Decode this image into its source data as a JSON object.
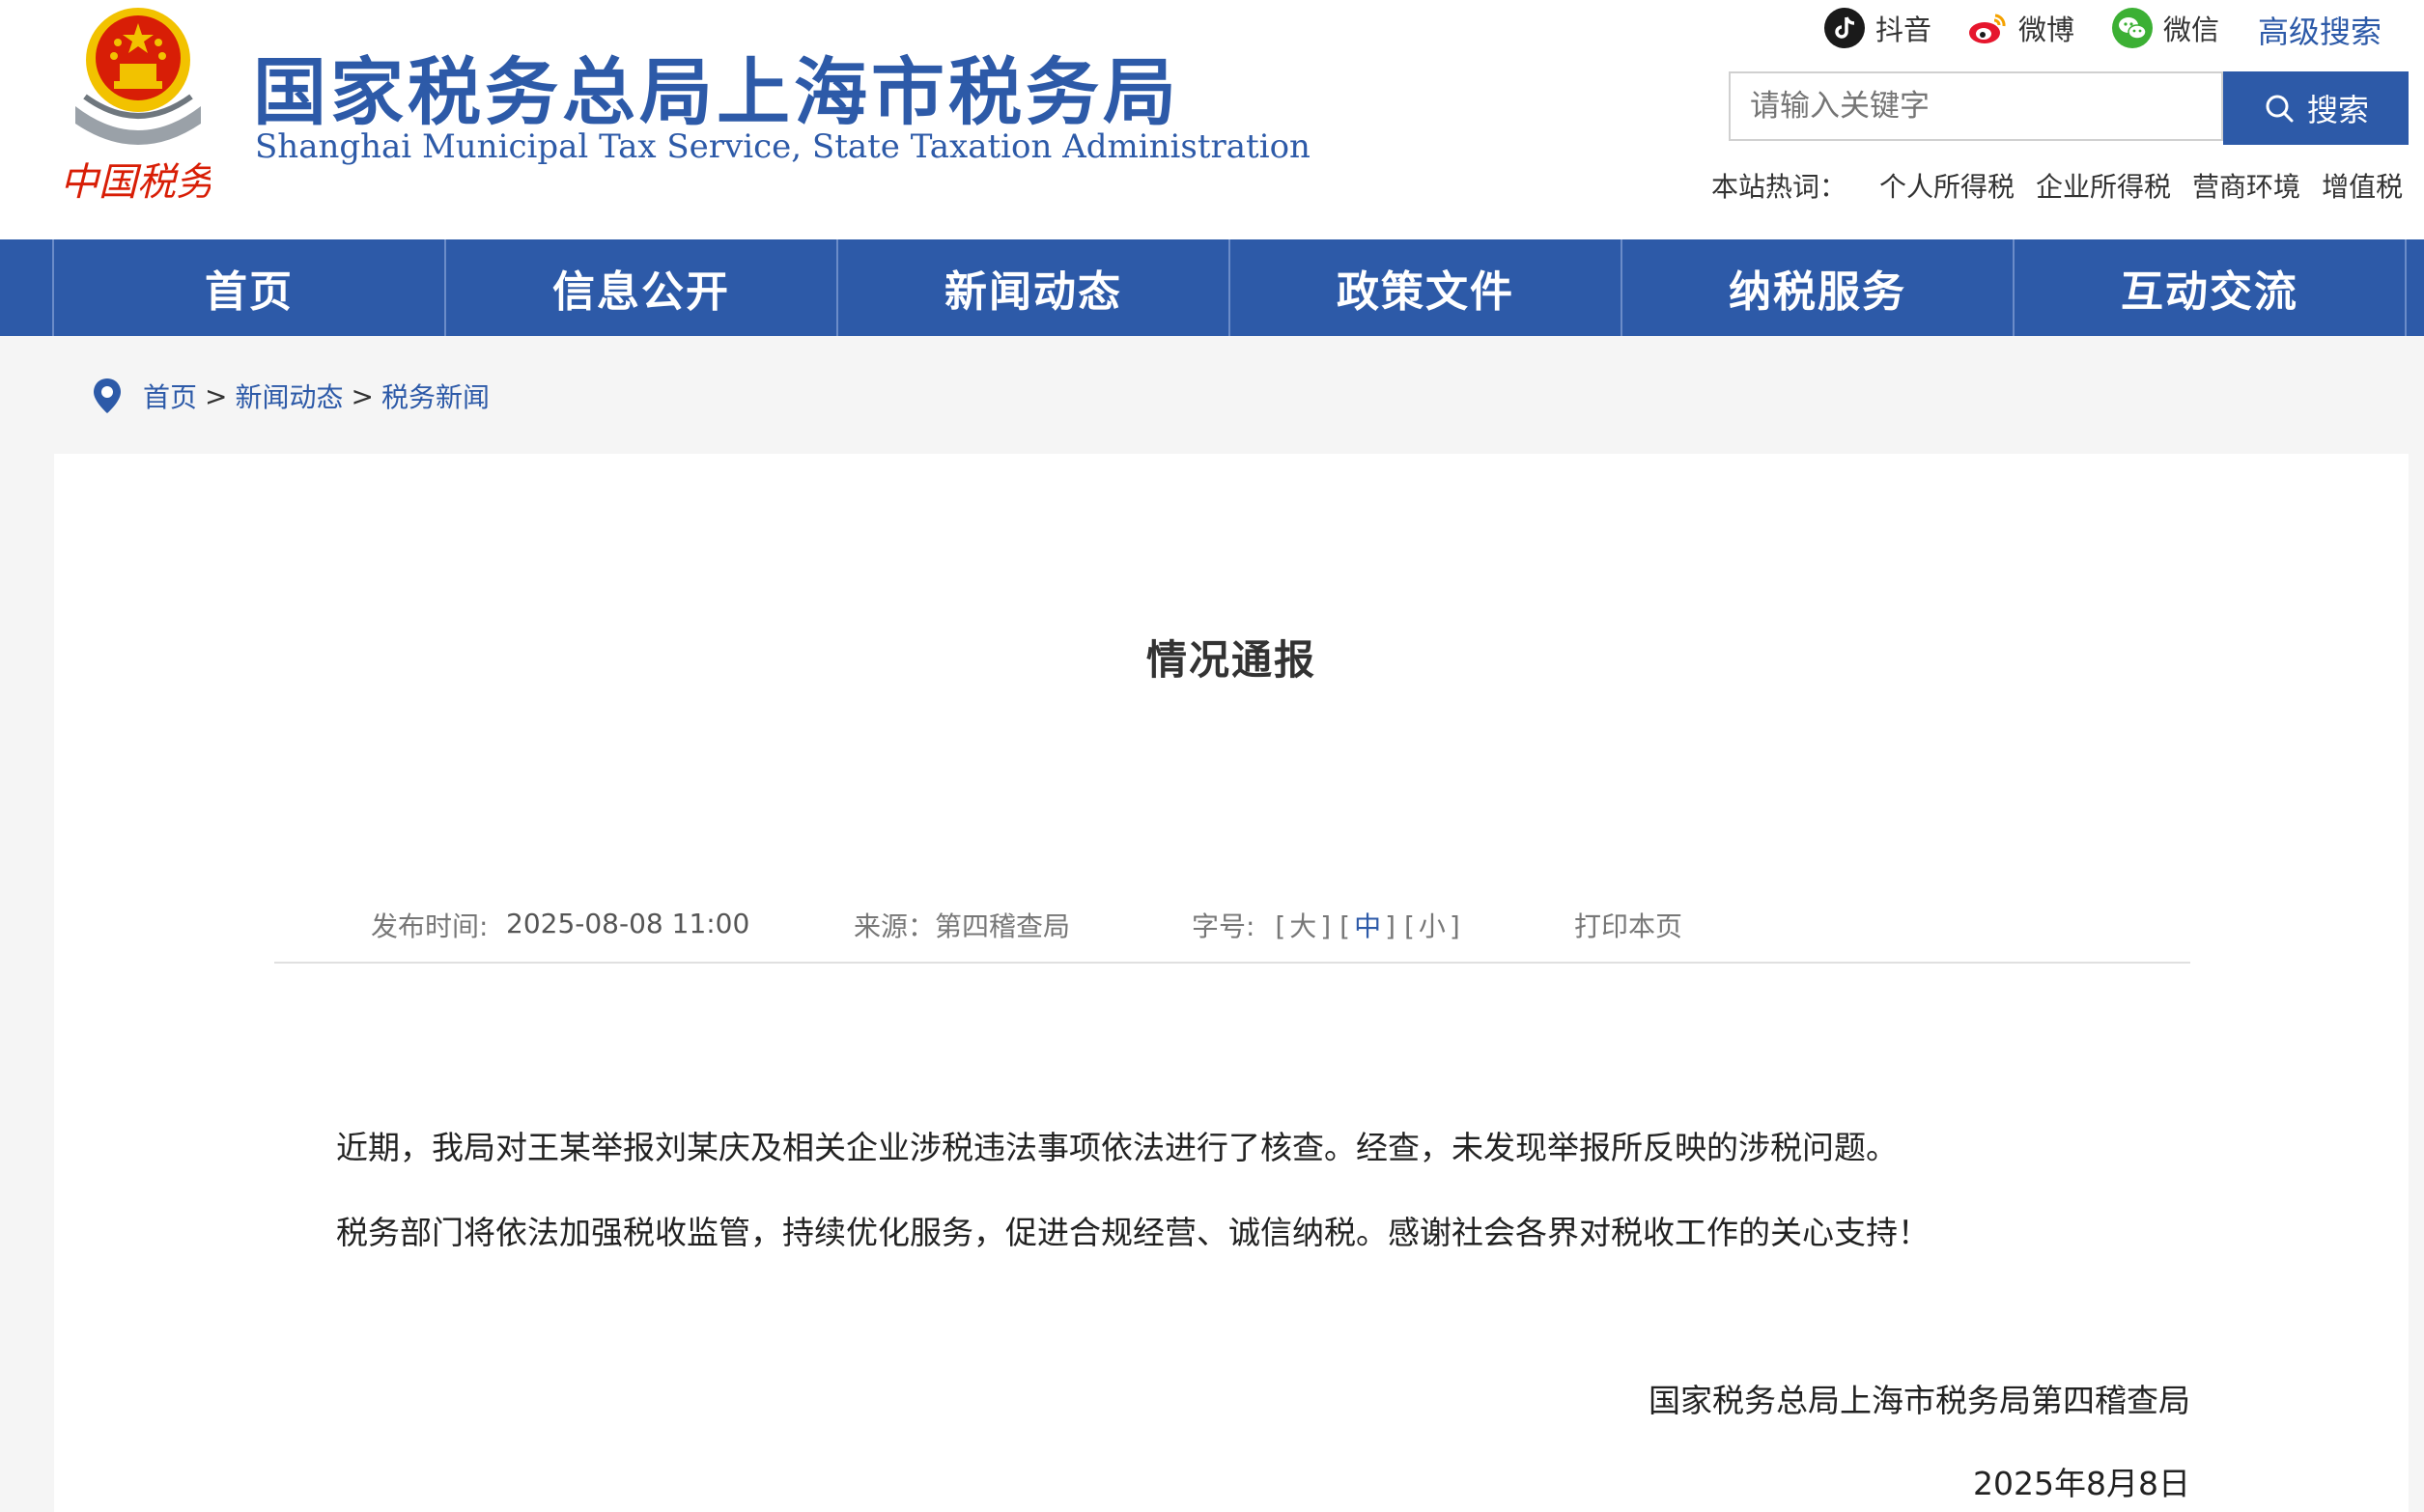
{
  "site": {
    "title_cn": "国家税务总局上海市税务局",
    "title_en": "Shanghai Municipal Tax Service, State Taxation Administration",
    "logo_text": "中国税务"
  },
  "social": [
    {
      "label": "抖音",
      "icon": "douyin-icon"
    },
    {
      "label": "微博",
      "icon": "weibo-icon"
    },
    {
      "label": "微信",
      "icon": "wechat-icon"
    }
  ],
  "header": {
    "advanced_search": "高级搜索",
    "search_placeholder": "请输入关键字",
    "search_button": "搜索",
    "hot_label": "本站热词：",
    "hot_words": [
      "个人所得税",
      "企业所得税",
      "营商环境",
      "增值税"
    ]
  },
  "nav": [
    "首页",
    "信息公开",
    "新闻动态",
    "政策文件",
    "纳税服务",
    "互动交流"
  ],
  "breadcrumb": {
    "home": "首页",
    "level1": "新闻动态",
    "level2": "税务新闻",
    "separator": ">"
  },
  "article": {
    "title": "情况通报",
    "meta": {
      "date_label": "发布时间:",
      "date": "2025-08-08 11:00",
      "source": "来源：第四稽查局",
      "font_label": "字号:",
      "font_large": "大",
      "font_medium": "中",
      "font_small": "小",
      "print": "打印本页"
    },
    "paragraphs": [
      "近期，我局对王某举报刘某庆及相关企业涉税违法事项依法进行了核查。经查，未发现举报所反映的涉税问题。",
      "税务部门将依法加强税收监管，持续优化服务，促进合规经营、诚信纳税。感谢社会各界对税收工作的关心支持！"
    ],
    "signature": "国家税务总局上海市税务局第四稽查局",
    "sign_date": "2025年8月8日"
  },
  "colors": {
    "brand_blue": "#2d5aa8",
    "emblem_red": "#d81e06",
    "emblem_gold": "#f2c200",
    "page_bg": "#f5f5f5"
  }
}
